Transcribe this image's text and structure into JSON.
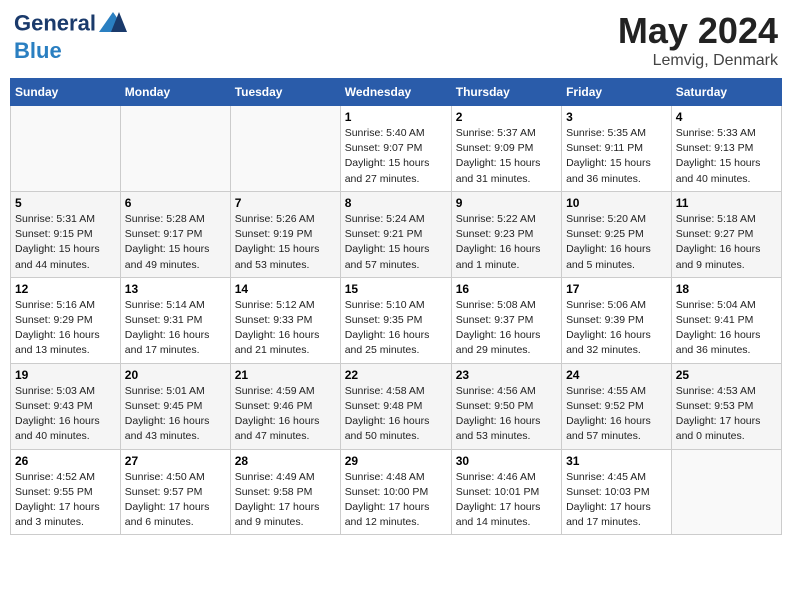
{
  "header": {
    "logo_line1": "General",
    "logo_line2": "Blue",
    "month_title": "May 2024",
    "location": "Lemvig, Denmark"
  },
  "days_header": [
    "Sunday",
    "Monday",
    "Tuesday",
    "Wednesday",
    "Thursday",
    "Friday",
    "Saturday"
  ],
  "weeks": [
    [
      {
        "num": "",
        "info": ""
      },
      {
        "num": "",
        "info": ""
      },
      {
        "num": "",
        "info": ""
      },
      {
        "num": "1",
        "info": "Sunrise: 5:40 AM\nSunset: 9:07 PM\nDaylight: 15 hours\nand 27 minutes."
      },
      {
        "num": "2",
        "info": "Sunrise: 5:37 AM\nSunset: 9:09 PM\nDaylight: 15 hours\nand 31 minutes."
      },
      {
        "num": "3",
        "info": "Sunrise: 5:35 AM\nSunset: 9:11 PM\nDaylight: 15 hours\nand 36 minutes."
      },
      {
        "num": "4",
        "info": "Sunrise: 5:33 AM\nSunset: 9:13 PM\nDaylight: 15 hours\nand 40 minutes."
      }
    ],
    [
      {
        "num": "5",
        "info": "Sunrise: 5:31 AM\nSunset: 9:15 PM\nDaylight: 15 hours\nand 44 minutes."
      },
      {
        "num": "6",
        "info": "Sunrise: 5:28 AM\nSunset: 9:17 PM\nDaylight: 15 hours\nand 49 minutes."
      },
      {
        "num": "7",
        "info": "Sunrise: 5:26 AM\nSunset: 9:19 PM\nDaylight: 15 hours\nand 53 minutes."
      },
      {
        "num": "8",
        "info": "Sunrise: 5:24 AM\nSunset: 9:21 PM\nDaylight: 15 hours\nand 57 minutes."
      },
      {
        "num": "9",
        "info": "Sunrise: 5:22 AM\nSunset: 9:23 PM\nDaylight: 16 hours\nand 1 minute."
      },
      {
        "num": "10",
        "info": "Sunrise: 5:20 AM\nSunset: 9:25 PM\nDaylight: 16 hours\nand 5 minutes."
      },
      {
        "num": "11",
        "info": "Sunrise: 5:18 AM\nSunset: 9:27 PM\nDaylight: 16 hours\nand 9 minutes."
      }
    ],
    [
      {
        "num": "12",
        "info": "Sunrise: 5:16 AM\nSunset: 9:29 PM\nDaylight: 16 hours\nand 13 minutes."
      },
      {
        "num": "13",
        "info": "Sunrise: 5:14 AM\nSunset: 9:31 PM\nDaylight: 16 hours\nand 17 minutes."
      },
      {
        "num": "14",
        "info": "Sunrise: 5:12 AM\nSunset: 9:33 PM\nDaylight: 16 hours\nand 21 minutes."
      },
      {
        "num": "15",
        "info": "Sunrise: 5:10 AM\nSunset: 9:35 PM\nDaylight: 16 hours\nand 25 minutes."
      },
      {
        "num": "16",
        "info": "Sunrise: 5:08 AM\nSunset: 9:37 PM\nDaylight: 16 hours\nand 29 minutes."
      },
      {
        "num": "17",
        "info": "Sunrise: 5:06 AM\nSunset: 9:39 PM\nDaylight: 16 hours\nand 32 minutes."
      },
      {
        "num": "18",
        "info": "Sunrise: 5:04 AM\nSunset: 9:41 PM\nDaylight: 16 hours\nand 36 minutes."
      }
    ],
    [
      {
        "num": "19",
        "info": "Sunrise: 5:03 AM\nSunset: 9:43 PM\nDaylight: 16 hours\nand 40 minutes."
      },
      {
        "num": "20",
        "info": "Sunrise: 5:01 AM\nSunset: 9:45 PM\nDaylight: 16 hours\nand 43 minutes."
      },
      {
        "num": "21",
        "info": "Sunrise: 4:59 AM\nSunset: 9:46 PM\nDaylight: 16 hours\nand 47 minutes."
      },
      {
        "num": "22",
        "info": "Sunrise: 4:58 AM\nSunset: 9:48 PM\nDaylight: 16 hours\nand 50 minutes."
      },
      {
        "num": "23",
        "info": "Sunrise: 4:56 AM\nSunset: 9:50 PM\nDaylight: 16 hours\nand 53 minutes."
      },
      {
        "num": "24",
        "info": "Sunrise: 4:55 AM\nSunset: 9:52 PM\nDaylight: 16 hours\nand 57 minutes."
      },
      {
        "num": "25",
        "info": "Sunrise: 4:53 AM\nSunset: 9:53 PM\nDaylight: 17 hours\nand 0 minutes."
      }
    ],
    [
      {
        "num": "26",
        "info": "Sunrise: 4:52 AM\nSunset: 9:55 PM\nDaylight: 17 hours\nand 3 minutes."
      },
      {
        "num": "27",
        "info": "Sunrise: 4:50 AM\nSunset: 9:57 PM\nDaylight: 17 hours\nand 6 minutes."
      },
      {
        "num": "28",
        "info": "Sunrise: 4:49 AM\nSunset: 9:58 PM\nDaylight: 17 hours\nand 9 minutes."
      },
      {
        "num": "29",
        "info": "Sunrise: 4:48 AM\nSunset: 10:00 PM\nDaylight: 17 hours\nand 12 minutes."
      },
      {
        "num": "30",
        "info": "Sunrise: 4:46 AM\nSunset: 10:01 PM\nDaylight: 17 hours\nand 14 minutes."
      },
      {
        "num": "31",
        "info": "Sunrise: 4:45 AM\nSunset: 10:03 PM\nDaylight: 17 hours\nand 17 minutes."
      },
      {
        "num": "",
        "info": ""
      }
    ]
  ]
}
